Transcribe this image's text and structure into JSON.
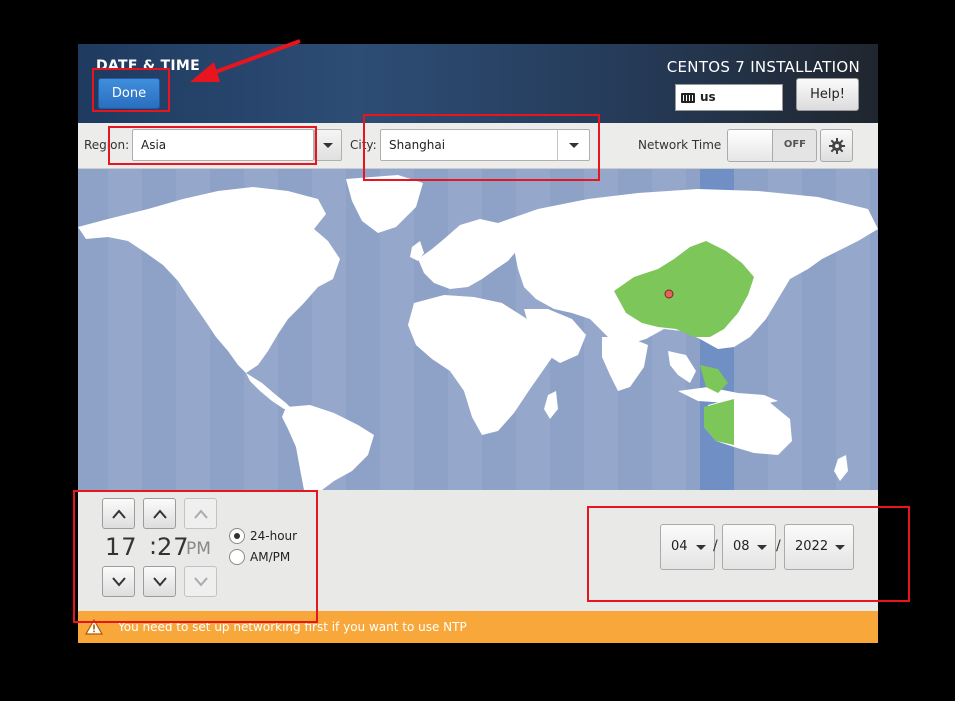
{
  "header": {
    "title": "DATE & TIME",
    "done_label": "Done",
    "install_title": "CENTOS 7 INSTALLATION",
    "keyboard_layout": "us",
    "help_label": "Help!"
  },
  "toolbar": {
    "region_label": "Region:",
    "region_value": "Asia",
    "city_label": "City:",
    "city_value": "Shanghai",
    "network_time_label": "Network Time",
    "network_time_state": "OFF"
  },
  "map": {
    "selected_timezone_color": "#7dc65a",
    "highlight_band_color": "#6f8fc5",
    "ocean_color": "#8ea2c7",
    "land_color": "#ffffff"
  },
  "time": {
    "hours": "17",
    "minutes": "27",
    "ampm": "PM",
    "format_24_label": "24-hour",
    "format_ampm_label": "AM/PM",
    "selected_format": "24-hour"
  },
  "date": {
    "month": "04",
    "day": "08",
    "year": "2022",
    "separator": "/"
  },
  "warning": {
    "text": "You need to set up networking first if you want to use NTP"
  },
  "colors": {
    "accent_blue": "#2f7fd1",
    "warning_orange": "#f8a83a",
    "annotation_red": "#e8141e"
  }
}
